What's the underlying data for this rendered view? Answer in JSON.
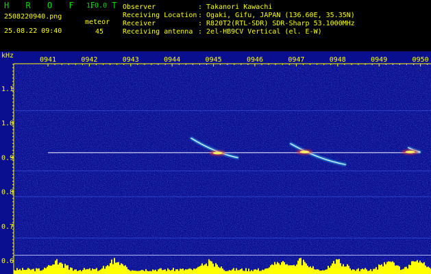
{
  "header": {
    "app_name": "H R O F F T",
    "app_version": "1.0.0",
    "filename": "2508220940.png",
    "datetime": "25.08.22 09:40",
    "meteor_label": "meteor",
    "meteor_count": "45",
    "info": [
      {
        "label": "Observer",
        "value": ": Takanori Kawachi"
      },
      {
        "label": "Receiving Location",
        "value": ": Ogaki, Gifu, JAPAN (136.60E, 35.35N)"
      },
      {
        "label": "Receiver",
        "value": ": R820T2(RTL-SDR) SDR-Sharp 53.1000MHz"
      },
      {
        "label": "Receiving antenna",
        "value": ": 2el-HB9CV Vertical (el. E-W)"
      }
    ]
  },
  "colors": {
    "app_name": "#00e000",
    "header_text": "#ffff00",
    "plot_background": "#0a0f90",
    "axis": "#ffff00",
    "signal_core": "#ffffff",
    "signal_glow": "#40e0ff",
    "histogram": "#ffff00"
  },
  "chart_data": {
    "type": "heatmap",
    "y_unit_label": "kHz",
    "x_ticks": [
      "0941",
      "0942",
      "0943",
      "0944",
      "0945",
      "0946",
      "0947",
      "0948",
      "0949",
      "0950"
    ],
    "y_ticks": [
      "1.1",
      "1.0",
      "0.9",
      "0.8",
      "0.7",
      "0.6"
    ],
    "y_tick_values": [
      1.1,
      1.0,
      0.9,
      0.8,
      0.7,
      0.6
    ],
    "x_range_minutes": [
      0,
      10
    ],
    "y_range_khz": [
      0.59,
      1.19
    ],
    "carrier": {
      "freq_khz": 0.913,
      "start_min": 1.0,
      "end_min": 10.0
    },
    "horizontal_lines_khz": [
      1.035,
      0.86,
      0.785,
      0.665,
      0.615
    ],
    "meteor_traces": [
      {
        "start_min": 4.45,
        "start_khz": 0.956,
        "end_min": 5.6,
        "end_khz": 0.898
      },
      {
        "start_min": 6.85,
        "start_khz": 0.94,
        "end_min": 8.2,
        "end_khz": 0.878
      },
      {
        "start_min": 9.7,
        "start_khz": 0.928,
        "end_min": 10.0,
        "end_khz": 0.915
      }
    ],
    "bright_spots": [
      {
        "t_min": 5.1,
        "khz": 0.912
      },
      {
        "t_min": 7.2,
        "khz": 0.915
      },
      {
        "t_min": 9.75,
        "khz": 0.915
      }
    ],
    "histogram_peaks_min": [
      1.2,
      2.6,
      4.9,
      6.6,
      7.1,
      8.0,
      9.2,
      9.9
    ]
  }
}
